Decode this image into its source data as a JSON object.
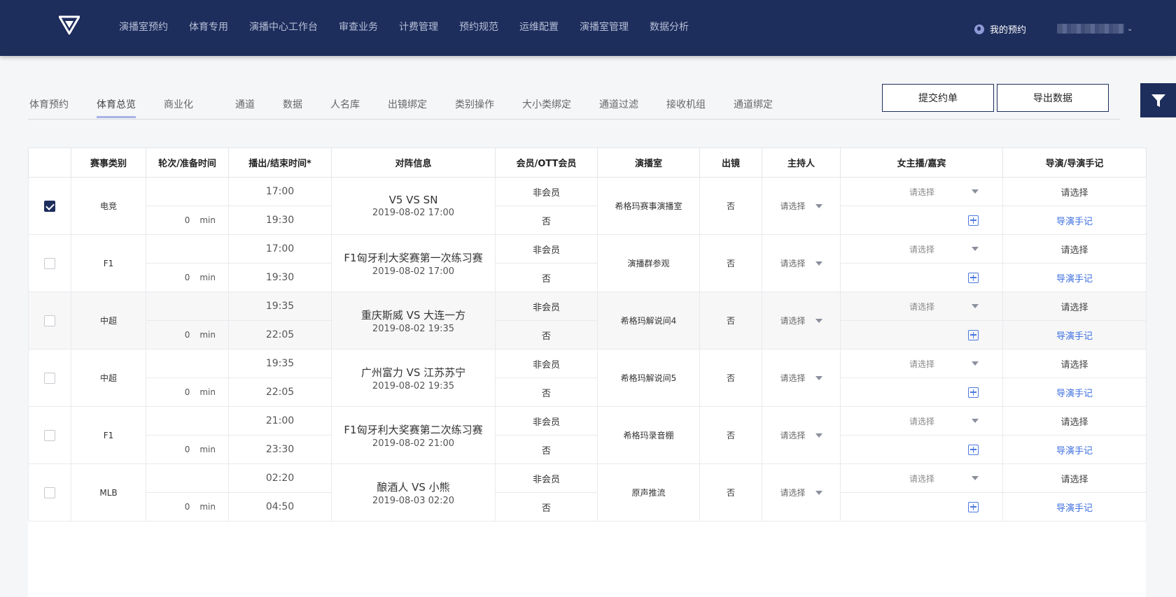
{
  "nav": {
    "items": [
      "演播室预约",
      "体育专用",
      "演播中心工作台",
      "审查业务",
      "计费管理",
      "预约规范",
      "运维配置",
      "演播室管理",
      "数据分析"
    ],
    "my_reservation": "我的预约"
  },
  "tabs": [
    "体育预约",
    "体育总览",
    "商业化",
    "通道",
    "数据",
    "人名库",
    "出镜绑定",
    "类别操作",
    "大小类绑定",
    "通道过滤",
    "接收机组",
    "通道绑定"
  ],
  "active_tab": "体育总览",
  "actions": {
    "submit": "提交约单",
    "export": "导出数据"
  },
  "table": {
    "headers": [
      "",
      "赛事类别",
      "轮次/准备时间",
      "播出/结束时间*",
      "对阵信息",
      "会员/OTT会员",
      "演播室",
      "出镜",
      "主持人",
      "女主播/嘉宾",
      "导演/导演手记"
    ],
    "unit": "min",
    "rows": [
      {
        "checked": true,
        "category": "电竞",
        "prep": "0",
        "start": "17:00",
        "end": "19:30",
        "match": "V5 VS SN",
        "date": "2019-08-02 17:00",
        "member": "非会员",
        "ott": "否",
        "studio": "希格玛赛事演播室",
        "oncam": "否",
        "host": "请选择",
        "guest": "请选择",
        "director": "请选择",
        "note": "导演手记"
      },
      {
        "checked": false,
        "category": "F1",
        "prep": "0",
        "start": "17:00",
        "end": "19:30",
        "match": "F1匈牙利大奖赛第一次练习赛",
        "date": "2019-08-02 17:00",
        "member": "非会员",
        "ott": "否",
        "studio": "演播群参观",
        "oncam": "否",
        "host": "请选择",
        "guest": "请选择",
        "director": "请选择",
        "note": "导演手记"
      },
      {
        "checked": false,
        "category": "中超",
        "prep": "0",
        "start": "19:35",
        "end": "22:05",
        "match": "重庆斯威 VS 大连一方",
        "date": "2019-08-02 19:35",
        "member": "非会员",
        "ott": "否",
        "studio": "希格玛解说间4",
        "oncam": "否",
        "host": "请选择",
        "guest": "请选择",
        "director": "请选择",
        "note": "导演手记"
      },
      {
        "checked": false,
        "category": "中超",
        "prep": "0",
        "start": "19:35",
        "end": "22:05",
        "match": "广州富力 VS 江苏苏宁",
        "date": "2019-08-02 19:35",
        "member": "非会员",
        "ott": "否",
        "studio": "希格玛解说间5",
        "oncam": "否",
        "host": "请选择",
        "guest": "请选择",
        "director": "请选择",
        "note": "导演手记"
      },
      {
        "checked": false,
        "category": "F1",
        "prep": "0",
        "start": "21:00",
        "end": "23:30",
        "match": "F1匈牙利大奖赛第二次练习赛",
        "date": "2019-08-02 21:00",
        "member": "非会员",
        "ott": "否",
        "studio": "希格玛录音棚",
        "oncam": "否",
        "host": "请选择",
        "guest": "请选择",
        "director": "请选择",
        "note": "导演手记"
      },
      {
        "checked": false,
        "category": "MLB",
        "prep": "0",
        "start": "02:20",
        "end": "04:50",
        "match": "酿酒人 VS 小熊",
        "date": "2019-08-03 02:20",
        "member": "非会员",
        "ott": "否",
        "studio": "原声推流",
        "oncam": "否",
        "host": "请选择",
        "guest": "请选择",
        "director": "请选择",
        "note": "导演手记"
      }
    ]
  }
}
